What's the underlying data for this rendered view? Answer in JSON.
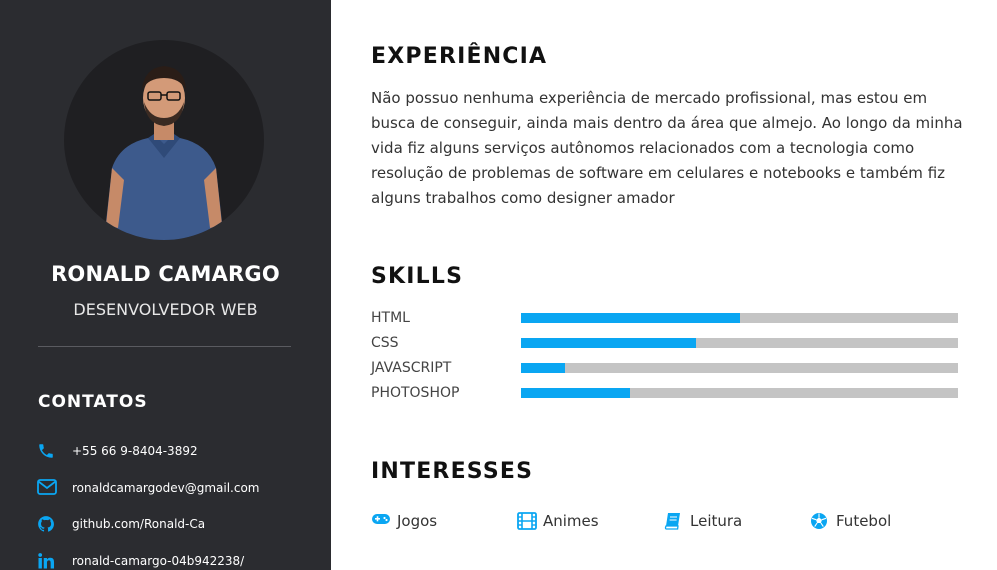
{
  "profile": {
    "name": "RONALD CAMARGO",
    "role": "DESENVOLVEDOR WEB"
  },
  "contacts": {
    "title": "CONTATOS",
    "items": [
      {
        "icon": "phone-icon",
        "text": "+55 66 9-8404-3892"
      },
      {
        "icon": "mail-icon",
        "text": "ronaldcamargodev@gmail.com"
      },
      {
        "icon": "github-icon",
        "text": "github.com/Ronald-Ca"
      },
      {
        "icon": "linkedin-icon",
        "text": "ronald-camargo-04b942238/"
      }
    ]
  },
  "experience": {
    "title": "EXPERIÊNCIA",
    "text": "Não possuo nenhuma experiência de mercado profissional, mas estou em busca de conseguir, ainda mais dentro da área que almejo. Ao longo da minha vida fiz alguns serviços autônomos relacionados com a tecnologia como resolução de problemas de software em celulares e notebooks e também fiz alguns trabalhos como designer amador"
  },
  "skills": {
    "title": "SKILLS",
    "items": [
      {
        "label": "HTML",
        "level": 50
      },
      {
        "label": "CSS",
        "level": 40
      },
      {
        "label": "JAVASCRIPT",
        "level": 10
      },
      {
        "label": "PHOTOSHOP",
        "level": 25
      }
    ]
  },
  "interests": {
    "title": "INTERESSES",
    "items": [
      {
        "icon": "gamepad-icon",
        "label": "Jogos"
      },
      {
        "icon": "film-icon",
        "label": "Animes"
      },
      {
        "icon": "book-icon",
        "label": "Leitura"
      },
      {
        "icon": "soccer-ball-icon",
        "label": "Futebol"
      }
    ]
  },
  "colors": {
    "sidebar_bg": "#2b2c30",
    "accent": "#0aa6f2",
    "bar_track": "#c4c4c4"
  }
}
